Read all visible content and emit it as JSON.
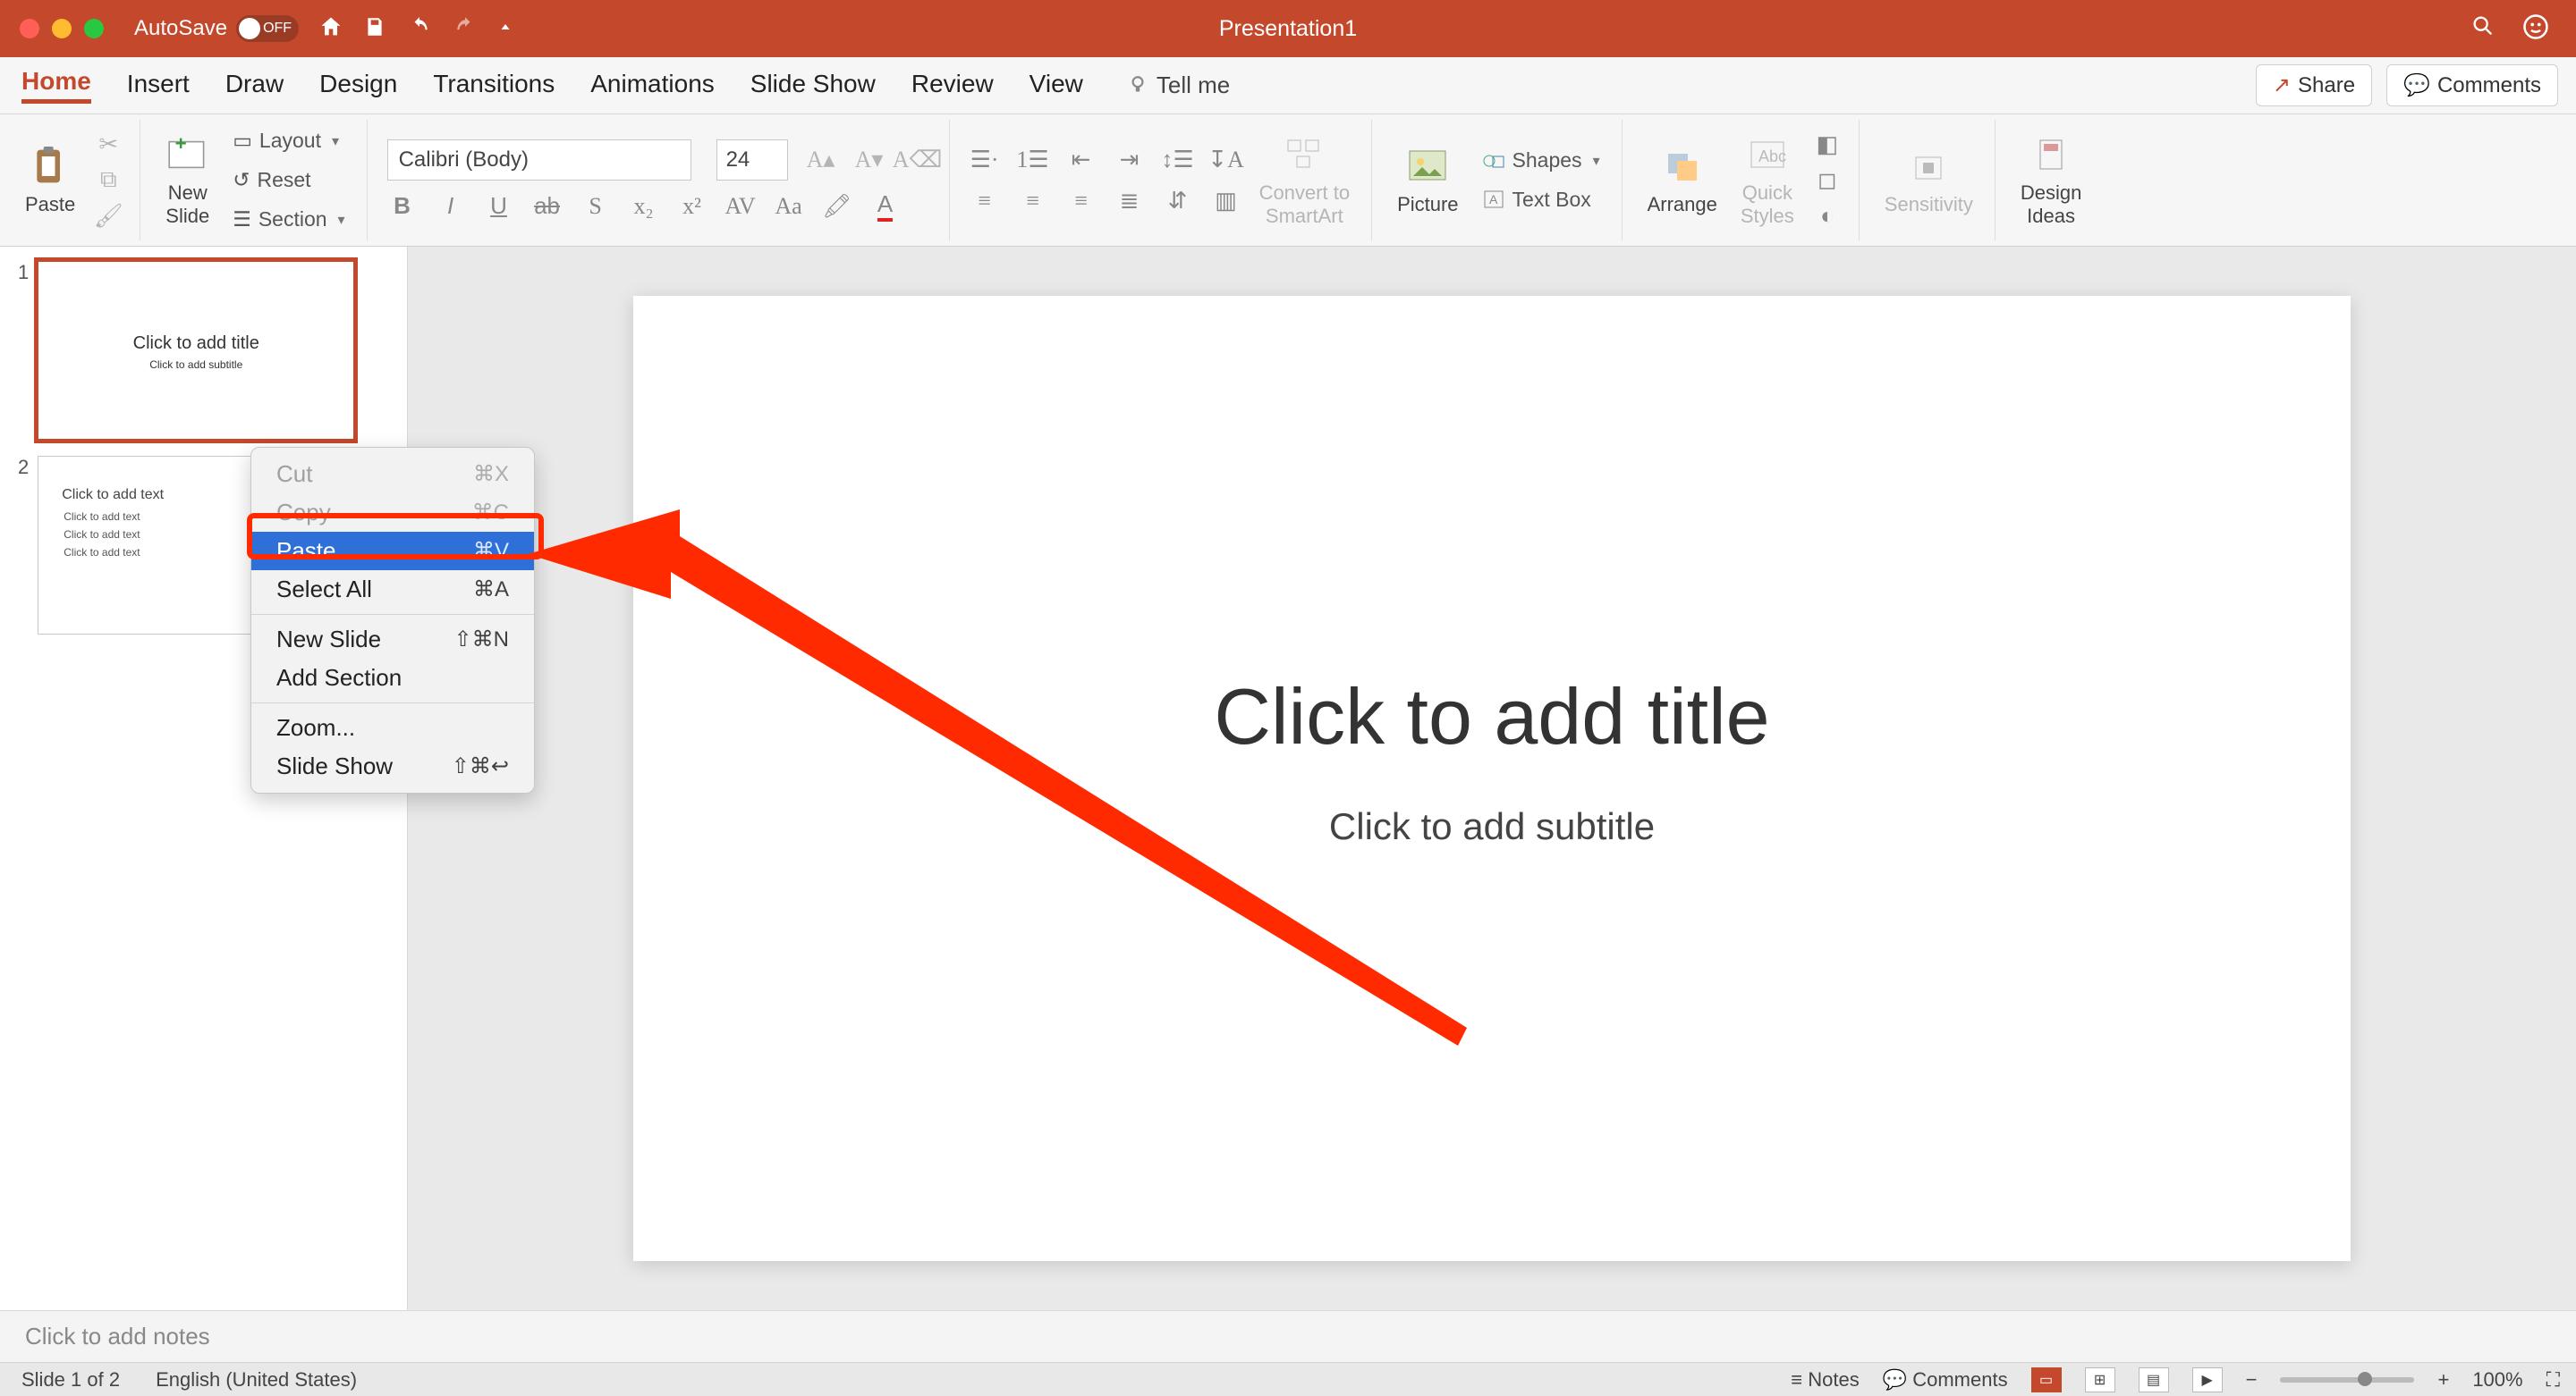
{
  "titlebar": {
    "autosave_label": "AutoSave",
    "autosave_state": "OFF",
    "doc_title": "Presentation1"
  },
  "tabs": {
    "items": [
      "Home",
      "Insert",
      "Draw",
      "Design",
      "Transitions",
      "Animations",
      "Slide Show",
      "Review",
      "View"
    ],
    "tellme": "Tell me",
    "share": "Share",
    "comments": "Comments",
    "active_index": 0
  },
  "ribbon": {
    "paste": "Paste",
    "new_slide": "New\nSlide",
    "layout": "Layout",
    "reset": "Reset",
    "section": "Section",
    "font_name": "Calibri (Body)",
    "font_size": "24",
    "convert": "Convert to\nSmartArt",
    "shapes": "Shapes",
    "picture": "Picture",
    "textbox": "Text Box",
    "arrange": "Arrange",
    "quick_styles": "Quick\nStyles",
    "sensitivity": "Sensitivity",
    "design_ideas": "Design\nIdeas"
  },
  "thumbnails": {
    "items": [
      {
        "num": "1",
        "title": "Click to add title",
        "subtitle": "Click to add subtitle",
        "selected": true,
        "layout": "title"
      },
      {
        "num": "2",
        "title": "Click to add text",
        "bullets": [
          "Click to add text",
          "Click to add text",
          "Click to add text"
        ],
        "selected": false,
        "layout": "content"
      }
    ]
  },
  "context_menu": {
    "items": [
      {
        "label": "Cut",
        "shortcut": "⌘X",
        "disabled": true
      },
      {
        "label": "Copy",
        "shortcut": "⌘C",
        "disabled": true
      },
      {
        "label": "Paste",
        "shortcut": "⌘V",
        "highlighted": true
      },
      {
        "label": "Select All",
        "shortcut": "⌘A"
      },
      {
        "sep": true
      },
      {
        "label": "New Slide",
        "shortcut": "⇧⌘N"
      },
      {
        "label": "Add Section",
        "shortcut": ""
      },
      {
        "sep": true
      },
      {
        "label": "Zoom...",
        "shortcut": ""
      },
      {
        "label": "Slide Show",
        "shortcut": "⇧⌘↩"
      }
    ]
  },
  "slide": {
    "title_placeholder": "Click to add title",
    "subtitle_placeholder": "Click to add subtitle"
  },
  "notes": {
    "placeholder": "Click to add notes"
  },
  "status": {
    "slide_info": "Slide 1 of 2",
    "language": "English (United States)",
    "notes": "Notes",
    "comments": "Comments",
    "zoom": "100%"
  }
}
